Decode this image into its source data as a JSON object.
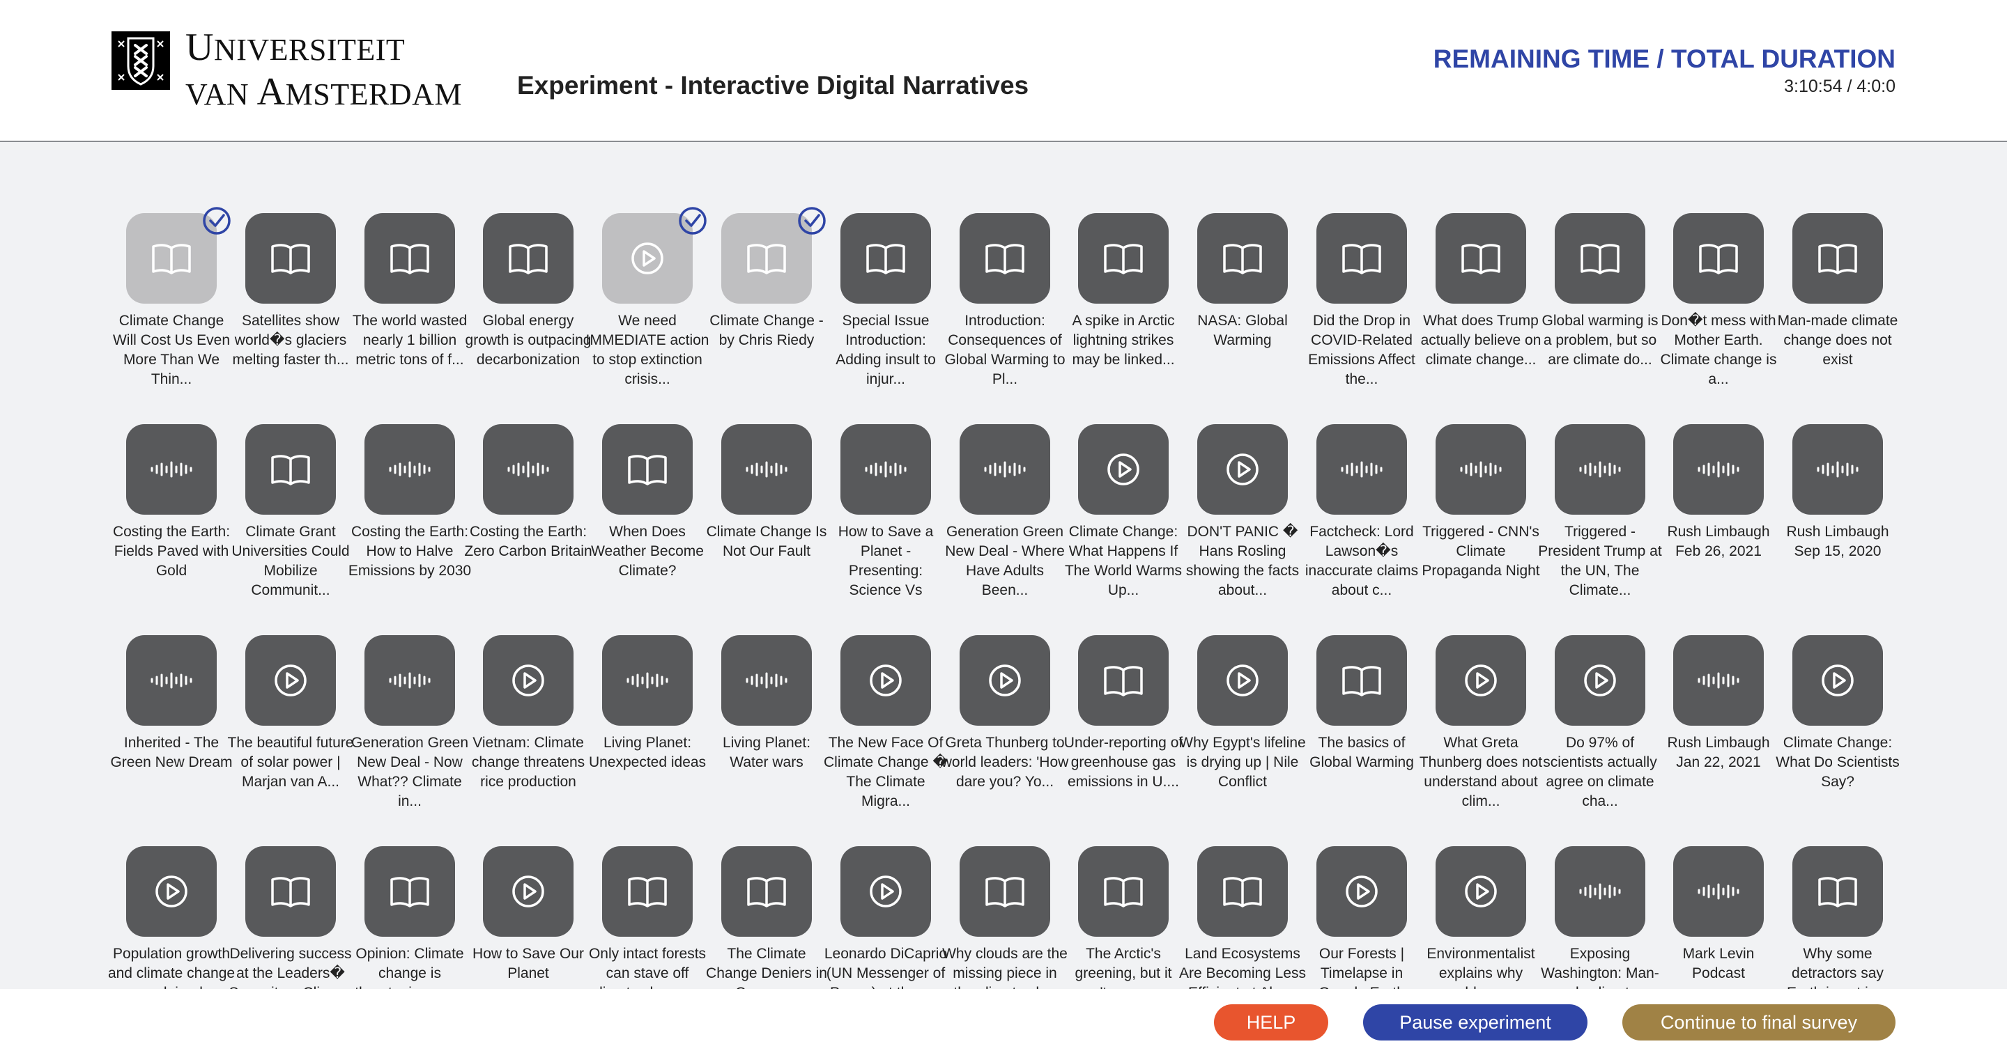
{
  "header": {
    "logo": {
      "line1_initial": "U",
      "line1_rest": "NIVERSITEIT",
      "line2_word1_initial": "VAN ",
      "line2_word2_initial": "A",
      "line2_rest": "MSTERDAM",
      "emblem": "xxx-emblem-icon"
    },
    "title": "Experiment - Interactive Digital Narratives",
    "timer_label": "REMAINING TIME / TOTAL DURATION",
    "timer_value": "3:10:54 / 4:0:0"
  },
  "colors": {
    "accent_blue": "#2f45a6",
    "tile_dark": "#58595b",
    "tile_watched": "#bfbfc1",
    "help": "#e8552e",
    "continue": "#a08245"
  },
  "rows": [
    [
      {
        "type": "book",
        "watched": true,
        "caption": "Climate Change Will Cost Us Even More Than We Thin..."
      },
      {
        "type": "book",
        "watched": false,
        "caption": "Satellites show world�s glaciers melting faster th..."
      },
      {
        "type": "book",
        "watched": false,
        "caption": "The world wasted nearly 1 billion metric tons of f..."
      },
      {
        "type": "book",
        "watched": false,
        "caption": "Global energy growth is outpacing decarbonization"
      },
      {
        "type": "video",
        "watched": true,
        "caption": "We need IMMEDIATE action to stop extinction crisis..."
      },
      {
        "type": "book",
        "watched": true,
        "caption": "Climate Change - by Chris Riedy"
      },
      {
        "type": "book",
        "watched": false,
        "caption": "Special Issue Introduction: Adding insult to injur..."
      },
      {
        "type": "book",
        "watched": false,
        "caption": "Introduction: Consequences of Global Warming to Pl..."
      },
      {
        "type": "book",
        "watched": false,
        "caption": "A spike in Arctic lightning strikes may be linked..."
      },
      {
        "type": "book",
        "watched": false,
        "caption": "NASA: Global Warming"
      },
      {
        "type": "book",
        "watched": false,
        "caption": "Did the Drop in COVID-Related Emissions Affect the..."
      },
      {
        "type": "book",
        "watched": false,
        "caption": "What does Trump actually believe on climate change..."
      },
      {
        "type": "book",
        "watched": false,
        "caption": "Global warming is a problem, but so are climate do..."
      },
      {
        "type": "book",
        "watched": false,
        "caption": "Don�t mess with Mother Earth. Climate change is a..."
      },
      {
        "type": "book",
        "watched": false,
        "caption": "Man-made climate change does not exist"
      }
    ],
    [
      {
        "type": "audio",
        "watched": false,
        "caption": "Costing the Earth: Fields Paved with Gold"
      },
      {
        "type": "book",
        "watched": false,
        "caption": "Climate Grant Universities Could Mobilize Communit..."
      },
      {
        "type": "audio",
        "watched": false,
        "caption": "Costing the Earth: How to Halve Emissions by 2030"
      },
      {
        "type": "audio",
        "watched": false,
        "caption": "Costing the Earth: Zero Carbon Britain"
      },
      {
        "type": "book",
        "watched": false,
        "caption": "When Does Weather Become Climate?"
      },
      {
        "type": "audio",
        "watched": false,
        "caption": "Climate Change Is Not Our Fault"
      },
      {
        "type": "audio",
        "watched": false,
        "caption": "How to Save a Planet - Presenting: Science Vs"
      },
      {
        "type": "audio",
        "watched": false,
        "caption": "Generation Green New Deal - Where Have Adults Been..."
      },
      {
        "type": "video",
        "watched": false,
        "caption": "Climate Change: What Happens If The World Warms Up..."
      },
      {
        "type": "video",
        "watched": false,
        "caption": "DON'T PANIC � Hans Rosling showing the facts about..."
      },
      {
        "type": "audio",
        "watched": false,
        "caption": "Factcheck: Lord Lawson�s inaccurate claims about c..."
      },
      {
        "type": "audio",
        "watched": false,
        "caption": "Triggered - CNN's Climate Propaganda Night"
      },
      {
        "type": "audio",
        "watched": false,
        "caption": "Triggered - President Trump at the UN, The Climate..."
      },
      {
        "type": "audio",
        "watched": false,
        "caption": "Rush Limbaugh Feb 26, 2021"
      },
      {
        "type": "audio",
        "watched": false,
        "caption": "Rush Limbaugh Sep 15, 2020"
      }
    ],
    [
      {
        "type": "audio",
        "watched": false,
        "caption": "Inherited - The Green New Dream"
      },
      {
        "type": "video",
        "watched": false,
        "caption": "The beautiful future of solar power | Marjan van A..."
      },
      {
        "type": "audio",
        "watched": false,
        "caption": "Generation Green New Deal - Now What?? Climate in..."
      },
      {
        "type": "video",
        "watched": false,
        "caption": "Vietnam: Climate change threatens rice production"
      },
      {
        "type": "audio",
        "watched": false,
        "caption": "Living Planet: Unexpected ideas"
      },
      {
        "type": "audio",
        "watched": false,
        "caption": "Living Planet: Water wars"
      },
      {
        "type": "video",
        "watched": false,
        "caption": "The New Face Of Climate Change � The Climate Migra..."
      },
      {
        "type": "video",
        "watched": false,
        "caption": "Greta Thunberg to world leaders: 'How dare you? Yo..."
      },
      {
        "type": "book",
        "watched": false,
        "caption": "Under-reporting of greenhouse gas emissions in U...."
      },
      {
        "type": "video",
        "watched": false,
        "caption": "Why Egypt's lifeline is drying up | Nile Conflict"
      },
      {
        "type": "book",
        "watched": false,
        "caption": "The basics of Global Warming"
      },
      {
        "type": "video",
        "watched": false,
        "caption": "What Greta Thunberg does not understand about clim..."
      },
      {
        "type": "video",
        "watched": false,
        "caption": "Do 97% of scientists actually agree on climate cha..."
      },
      {
        "type": "audio",
        "watched": false,
        "caption": "Rush Limbaugh Jan 22, 2021"
      },
      {
        "type": "video",
        "watched": false,
        "caption": "Climate Change: What Do Scientists Say?"
      }
    ],
    [
      {
        "type": "video",
        "watched": false,
        "caption": "Population growth and climate change explained"
      },
      {
        "type": "book",
        "watched": false,
        "caption": "Delivering success at the Leaders� Summit on Clima..."
      },
      {
        "type": "book",
        "watched": false,
        "caption": "Opinion: Climate change is threatening our..."
      },
      {
        "type": "video",
        "watched": false,
        "caption": "How to Save Our Planet"
      },
      {
        "type": "book",
        "watched": false,
        "caption": "Only intact forests can stave off climate change..."
      },
      {
        "type": "book",
        "watched": false,
        "caption": "The Climate Change Deniers in Congress"
      },
      {
        "type": "video",
        "watched": false,
        "caption": "Leonardo DiCaprio (UN Messenger of Peace) at the o..."
      },
      {
        "type": "book",
        "watched": false,
        "caption": "Why clouds are the missing piece in the climate ch..."
      },
      {
        "type": "book",
        "watched": false,
        "caption": "The Arctic's greening, but it won't save us..."
      },
      {
        "type": "book",
        "watched": false,
        "caption": "Land Ecosystems Are Becoming Less Efficient at Abs..."
      },
      {
        "type": "video",
        "watched": false,
        "caption": "Our Forests | Timelapse in Google Earth"
      },
      {
        "type": "video",
        "watched": false,
        "caption": "Environmentalist explains why renewable energy..."
      },
      {
        "type": "audio",
        "watched": false,
        "caption": "Exposing Washington: Man-made climate..."
      },
      {
        "type": "audio",
        "watched": false,
        "caption": "Mark Levin Podcast"
      },
      {
        "type": "book",
        "watched": false,
        "caption": "Why some detractors say Earth is not in..."
      }
    ]
  ],
  "footer": {
    "help_label": "HELP",
    "pause_label": "Pause experiment",
    "continue_label": "Continue to final survey"
  }
}
